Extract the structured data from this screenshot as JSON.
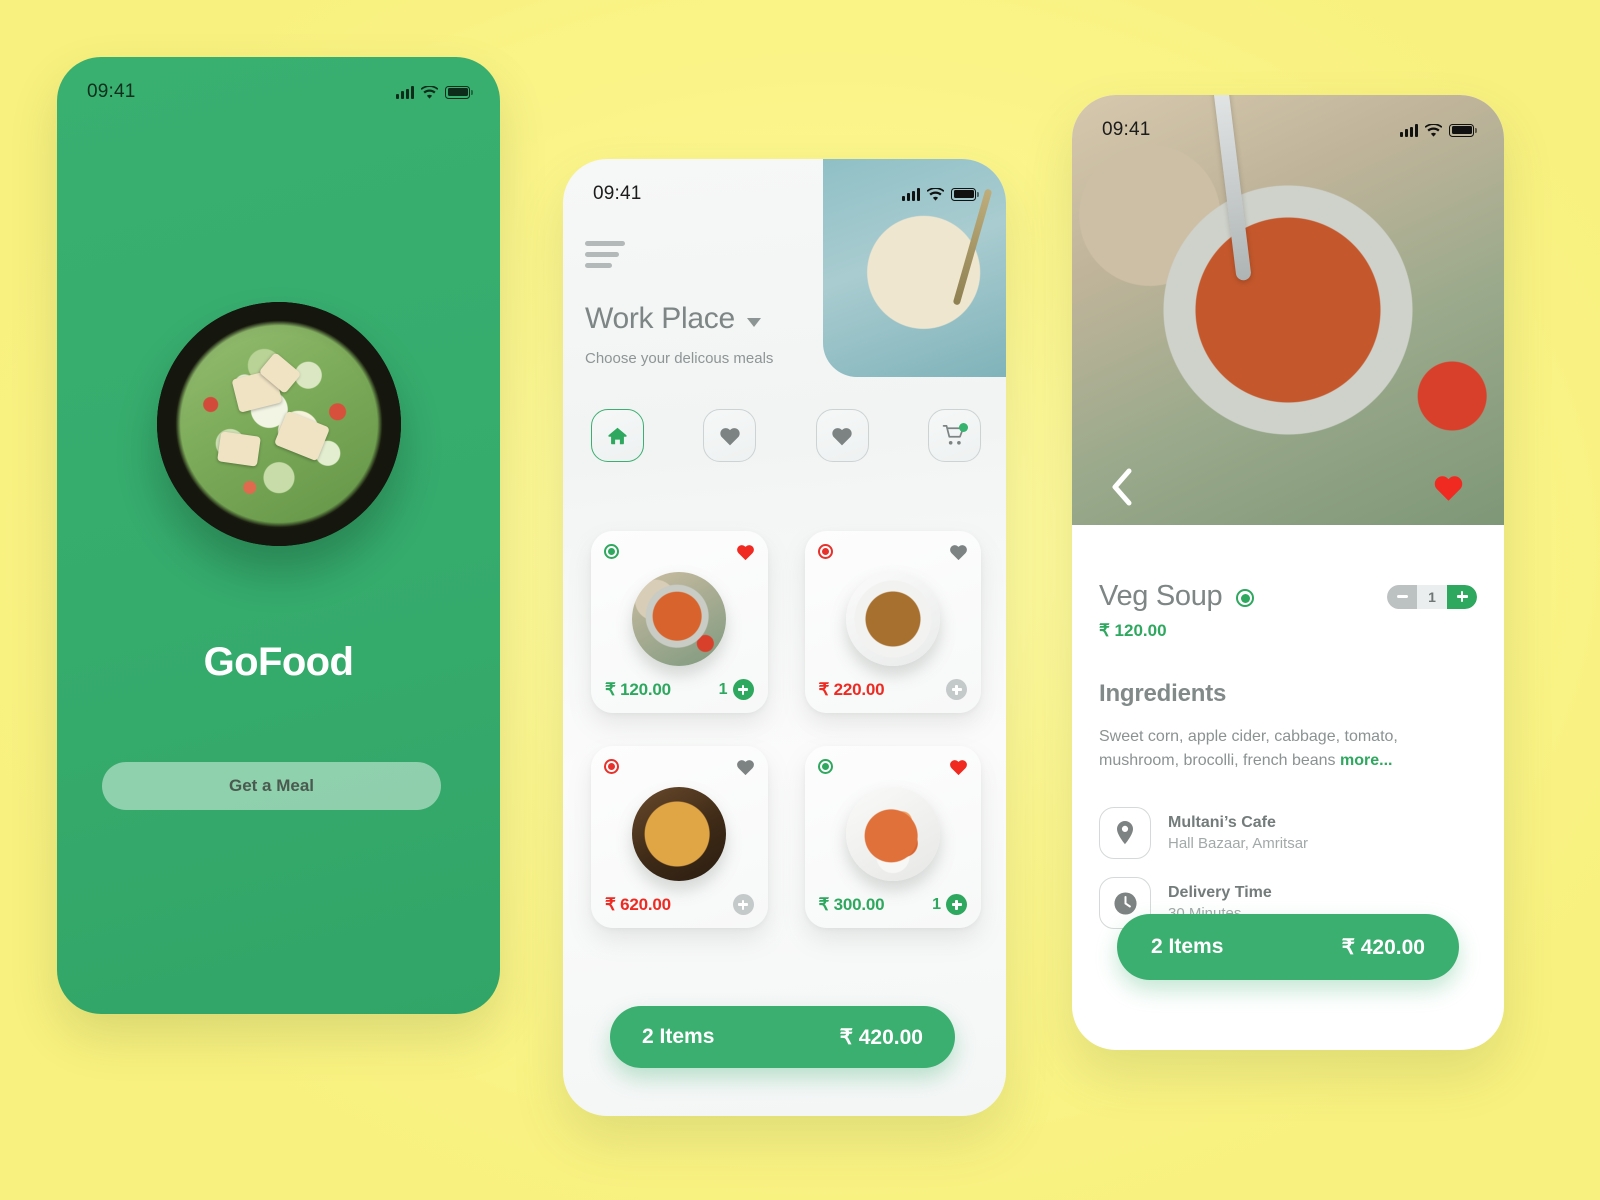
{
  "brand": {
    "name": "GoFood"
  },
  "accent": {
    "green": "#3BAF70",
    "green_text": "#2FA85F",
    "red": "#EE2B22",
    "background": "#FAF684"
  },
  "screen1": {
    "status": {
      "time": "09:41",
      "signal_icon": "signal-bars-icon",
      "wifi_icon": "wifi-icon",
      "battery_icon": "battery-icon"
    },
    "dish_image": "salad-bowl-image",
    "title": "GoFood",
    "cta_label": "Get a Meal"
  },
  "screen2": {
    "status": {
      "time": "09:41",
      "signal_icon": "signal-bars-icon",
      "wifi_icon": "wifi-icon",
      "battery_icon": "battery-icon"
    },
    "menu_icon": "hamburger-menu-icon",
    "header_image": "noodle-bowl-image",
    "location_label": "Work Place",
    "location_caret": "chevron-down-icon",
    "subtitle": "Choose your delicous meals",
    "nav": [
      {
        "name": "home",
        "icon": "home-icon",
        "active": true,
        "badge": false
      },
      {
        "name": "favorites",
        "icon": "heart-icon",
        "active": false,
        "badge": false
      },
      {
        "name": "liked",
        "icon": "heart-icon",
        "active": false,
        "badge": false
      },
      {
        "name": "cart",
        "icon": "shopping-cart-icon",
        "active": false,
        "badge": true
      }
    ],
    "cards": [
      {
        "veg": true,
        "favorited": true,
        "image": "soup-bowl-image",
        "price": "₹ 120.00",
        "qty": "1",
        "has_qty": true,
        "plus_active": true
      },
      {
        "veg": false,
        "favorited": false,
        "image": "salad-bowl-image",
        "price": "₹ 220.00",
        "qty": "",
        "has_qty": false,
        "plus_active": false
      },
      {
        "veg": false,
        "favorited": false,
        "image": "pizza-image",
        "price": "₹ 620.00",
        "qty": "",
        "has_qty": false,
        "plus_active": false
      },
      {
        "veg": true,
        "favorited": true,
        "image": "chicken-bowl-image",
        "price": "₹ 300.00",
        "qty": "1",
        "has_qty": true,
        "plus_active": true
      }
    ],
    "cartbar": {
      "items_label": "2 Items",
      "total": "₹ 420.00"
    }
  },
  "screen3": {
    "status": {
      "time": "09:41",
      "signal_icon": "signal-bars-icon",
      "wifi_icon": "wifi-icon",
      "battery_icon": "battery-icon"
    },
    "hero_image": "veg-soup-pot-image",
    "back_icon": "chevron-left-icon",
    "favorite_icon": "heart-icon",
    "favorited": true,
    "dish_name": "Veg Soup",
    "is_veg": true,
    "quantity": "1",
    "price": "₹ 120.00",
    "ingredients_heading": "Ingredients",
    "ingredients_text": "Sweet corn, apple cider, cabbage, tomato, mushroom, brocolli, french beans ",
    "more_label": "more...",
    "info": [
      {
        "icon": "location-pin-icon",
        "title": "Multani’s Cafe",
        "subtitle": "Hall Bazaar, Amritsar"
      },
      {
        "icon": "clock-icon",
        "title": "Delivery Time",
        "subtitle": "30 Minutes"
      }
    ],
    "cartbar": {
      "items_label": "2 Items",
      "total": "₹ 420.00"
    }
  }
}
